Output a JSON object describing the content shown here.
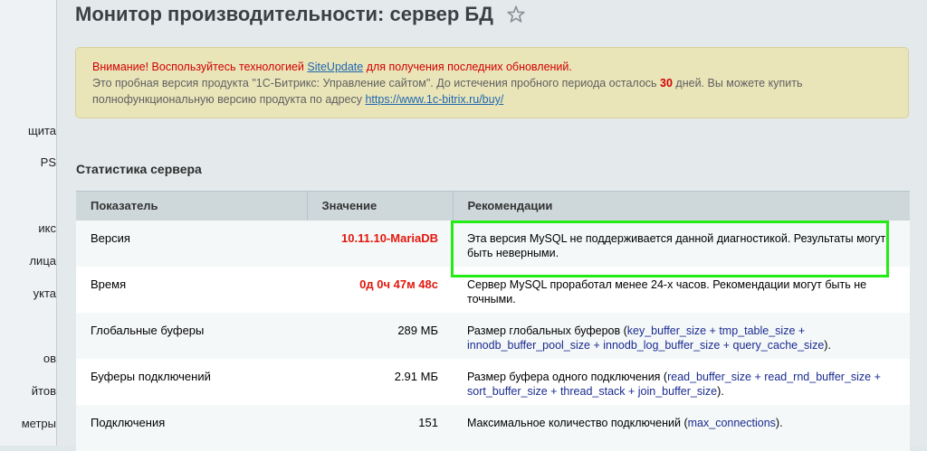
{
  "sidebar": {
    "items": [
      "щита",
      "PS",
      "икс",
      "лица",
      "укта",
      "ов",
      "йтов",
      "метры"
    ]
  },
  "header": {
    "title": "Монитор производительности: сервер БД"
  },
  "notice": {
    "warning_prefix": "Внимание! Воспользуйтесь технологией ",
    "siteupdate_link": "SiteUpdate",
    "warning_suffix": " для получения последних обновлений.",
    "trial_text_1": "Это пробная версия продукта \"1С-Битрикс: Управление сайтом\". До истечения пробного периода осталось ",
    "days": "30",
    "trial_text_2": " дней. Вы можете купить полнофункциональную версию продукта по адресу ",
    "buy_link": "https://www.1c-bitrix.ru/buy/"
  },
  "section": {
    "title": "Статистика сервера"
  },
  "table": {
    "headers": [
      "Показатель",
      "Значение",
      "Рекомендации"
    ],
    "rows": [
      {
        "name": "Версия",
        "value": "10.11.10-MariaDB",
        "rec": "Эта версия MySQL не поддерживается данной диагностикой. Результаты могут быть неверными."
      },
      {
        "name": "Время",
        "value": "0д 0ч 47м 48с",
        "rec": "Сервер MySQL проработал менее 24-х часов. Рекомендации могут быть не точными."
      },
      {
        "name": "Глобальные буферы",
        "value": "289 МБ",
        "rec_prefix": "Размер глобальных буферов (",
        "rec_params": "key_buffer_size + tmp_table_size + innodb_buffer_pool_size + innodb_log_buffer_size + query_cache_size",
        "rec_suffix": ")."
      },
      {
        "name": "Буферы подключений",
        "value": "2.91 МБ",
        "rec_prefix": "Размер буфера одного подключения (",
        "rec_params": "read_buffer_size + read_rnd_buffer_size + sort_buffer_size + thread_stack + join_buffer_size",
        "rec_suffix": ")."
      },
      {
        "name": "Подключения",
        "value": "151",
        "rec_prefix": "Максимальное количество подключений (",
        "rec_params": "max_connections",
        "rec_suffix": ")."
      }
    ]
  },
  "icons": {
    "favorite": "star-icon"
  },
  "colors": {
    "warning_red": "#d20000",
    "value_red": "#e3170d",
    "link_blue": "#2067b0",
    "param_navy": "#1a2b8f",
    "highlight_green": "#22ec14",
    "notice_bg": "#e9e5b9",
    "table_header_bg": "#ced8db"
  }
}
